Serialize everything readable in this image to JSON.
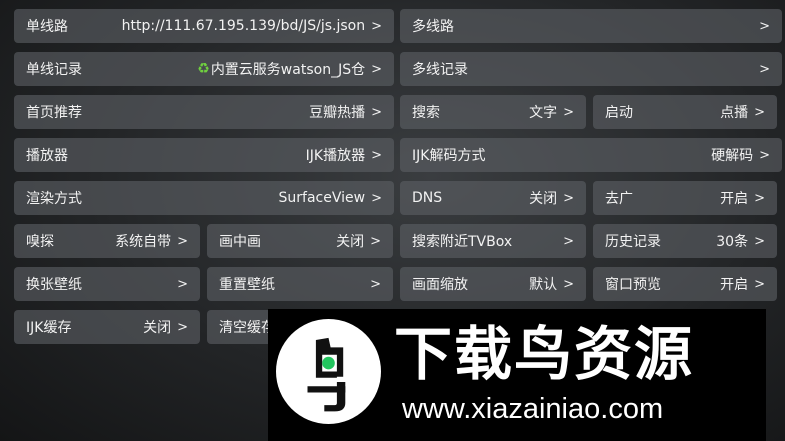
{
  "settings": {
    "single_line": {
      "label": "单线路",
      "value": "http://111.67.195.139/bd/JS/js.json"
    },
    "multi_line": {
      "label": "多线路",
      "value": ""
    },
    "single_record": {
      "label": "单线记录",
      "icon": "recycle-icon",
      "value": "内置云服务watson_JS仓"
    },
    "multi_record": {
      "label": "多线记录",
      "value": ""
    },
    "home_recommend": {
      "label": "首页推荐",
      "value": "豆瓣热播"
    },
    "search": {
      "label": "搜索",
      "value": "文字"
    },
    "startup": {
      "label": "启动",
      "value": "点播"
    },
    "player": {
      "label": "播放器",
      "value": "IJK播放器"
    },
    "ijk_decode": {
      "label": "IJK解码方式",
      "value": "硬解码"
    },
    "render": {
      "label": "渲染方式",
      "value": "SurfaceView"
    },
    "dns": {
      "label": "DNS",
      "value": "关闭"
    },
    "ad_remove": {
      "label": "去广",
      "value": "开启"
    },
    "sniff": {
      "label": "嗅探",
      "value": "系统自带"
    },
    "pip": {
      "label": "画中画",
      "value": "关闭"
    },
    "search_nearby": {
      "label": "搜索附近TVBox",
      "value": ""
    },
    "history": {
      "label": "历史记录",
      "value": "30条"
    },
    "change_wallpaper": {
      "label": "换张壁纸",
      "value": ""
    },
    "reset_wallpaper": {
      "label": "重置壁纸",
      "value": ""
    },
    "zoom": {
      "label": "画面缩放",
      "value": "默认"
    },
    "window_preview": {
      "label": "窗口预览",
      "value": "开启"
    },
    "ijk_cache": {
      "label": "IJK缓存",
      "value": "关闭"
    },
    "clear_cache": {
      "label": "清空缓存",
      "value": ""
    },
    "chevron": ">"
  },
  "watermark": {
    "title": "下载鸟资源",
    "url": "www.xiazainiao.com",
    "accent": "#22c55e"
  }
}
